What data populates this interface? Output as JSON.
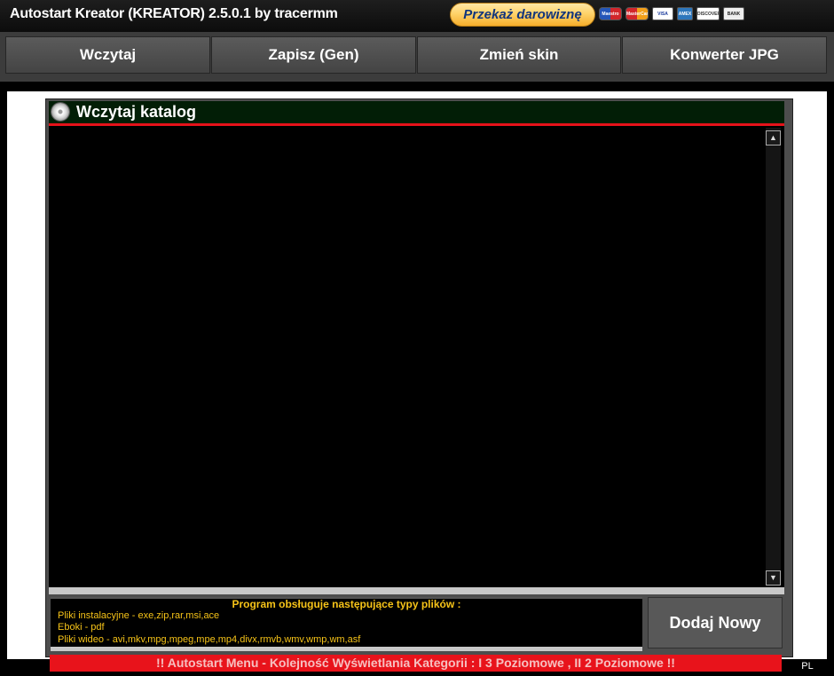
{
  "window": {
    "title": "Autostart Kreator (KREATOR) 2.5.0.1 by tracermm"
  },
  "donate": {
    "label": "Przekaż darowiznę",
    "cards": [
      "Maestro",
      "MasterCard",
      "VISA",
      "AMEX",
      "DISCOVER",
      "BANK"
    ]
  },
  "toolbar": {
    "buttons": [
      {
        "label": "Wczytaj"
      },
      {
        "label": "Zapisz (Gen)"
      },
      {
        "label": "Zmień skin"
      },
      {
        "label": "Konwerter JPG"
      }
    ]
  },
  "panel": {
    "title": "Wczytaj katalog",
    "icon": "disc-icon"
  },
  "scrollbar": {
    "up_glyph": "▲",
    "down_glyph": "▼"
  },
  "info": {
    "heading": "Program obsługuje następujące typy plików :",
    "lines": [
      "Pliki instalacyjne - exe,zip,rar,msi,ace",
      "Eboki - pdf",
      "Pliki wideo - avi,mkv,mpg,mpeg,mpe,mp4,divx,rmvb,wmv,wmp,wm,asf"
    ]
  },
  "actions": {
    "add_label": "Dodaj Nowy"
  },
  "status": {
    "text": "!! Autostart Menu - Kolejność Wyświetlania Kategorii : I 3 Poziomowe , II 2 Poziomowe !!"
  },
  "language": "PL",
  "colors": {
    "accent_red": "#e8131b",
    "info_text": "#f6c318",
    "header_bg": "#021e06"
  }
}
